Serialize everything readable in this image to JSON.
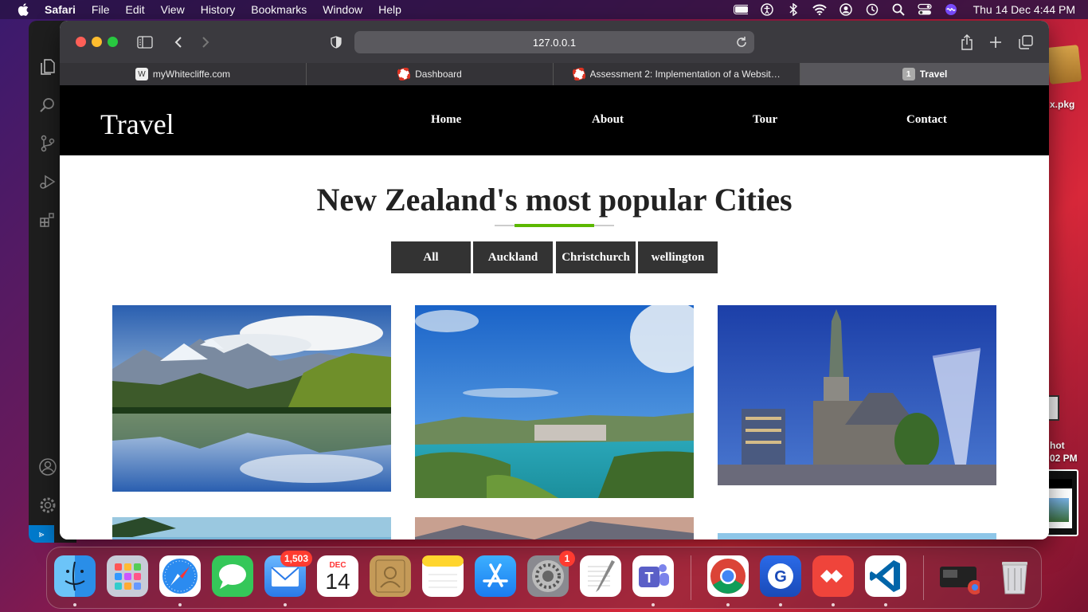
{
  "menubar": {
    "app_name": "Safari",
    "menus": [
      "File",
      "Edit",
      "View",
      "History",
      "Bookmarks",
      "Window",
      "Help"
    ],
    "clock": "Thu 14 Dec  4:44 PM"
  },
  "desktop": {
    "pkg_label": "x.pkg",
    "screenshot_label_1": "hot",
    "screenshot_label_2": "02 PM"
  },
  "safari": {
    "url": "127.0.0.1",
    "tabs": [
      {
        "label": "myWhitecliffe.com",
        "icon": "w-logo-icon"
      },
      {
        "label": "Dashboard",
        "icon": "lifebuoy-icon"
      },
      {
        "label": "Assessment 2: Implementation of a Website t...",
        "icon": "lifebuoy-icon"
      },
      {
        "label": "Travel",
        "icon": "number-icon",
        "badge": "1"
      }
    ]
  },
  "site": {
    "brand": "Travel",
    "nav": [
      "Home",
      "About",
      "Tour",
      "Contact"
    ],
    "heading": "New Zealand's most popular Cities",
    "filters": [
      "All",
      "Auckland",
      "Christchurch",
      "wellington"
    ],
    "accent_color": "#5cb800"
  },
  "dock": {
    "apps": [
      "Finder",
      "Launchpad",
      "Safari",
      "Messages",
      "Mail",
      "Calendar",
      "Contacts",
      "Notes",
      "App Store",
      "System Preferences",
      "TextEdit",
      "Microsoft Teams",
      "Google Chrome",
      "Grammarly",
      "AnyDesk",
      "Visual Studio Code",
      "Downloads",
      "Trash"
    ],
    "mail_badge": "1,503",
    "settings_badge": "1",
    "calendar_month": "DEC",
    "calendar_day": "14"
  }
}
